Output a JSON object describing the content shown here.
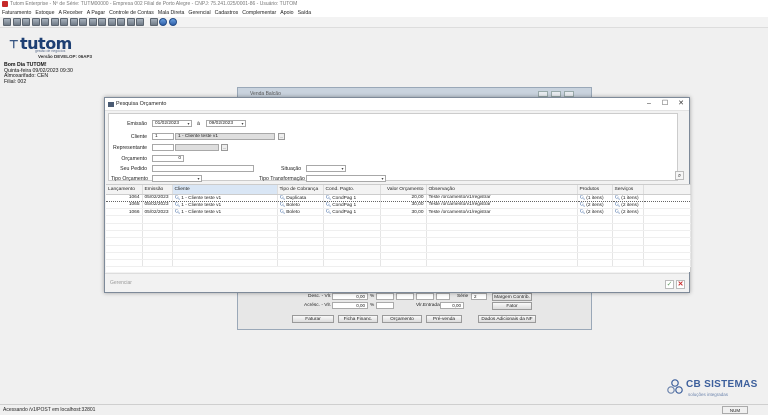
{
  "window": {
    "title": "Tutom Enterprise - Nº de Série: TUTM00000 - Empresa 002 Filial de Porto Alegre - CNPJ: 75.241.025/0001-86 - Usuário: TUTOM"
  },
  "menu": [
    "Faturamento",
    "Estoque",
    "A Receber",
    "A Pagar",
    "Controle de Contas",
    "Mala Direta",
    "Gerencial",
    "Cadastros",
    "Complementar",
    "Apoio",
    "Saída"
  ],
  "brand": {
    "name": "tutom",
    "tagline": "gestão de negócios",
    "version": "Versão DEVELOP: 06AP3"
  },
  "welcome": {
    "greeting": "Bom Dia TUTOM!",
    "date": "Quinta-feira 09/02/2023  09:30",
    "warehouse": "Almoxarifado: CEN",
    "branch": "Filial: 002"
  },
  "background_window": {
    "title": "Venda Balcão",
    "desc_label": "Desc. - Vlr.",
    "desc_value": "0,00",
    "acresc_label": "Acrésc. - Vlr.",
    "acresc_value": "0,00",
    "pct": "%",
    "entrada_label": "Vlr.Entrada",
    "entrada_value": "0,00",
    "serie_label": "Série",
    "serie_value": "2",
    "margem_label": "Margem Contrib.",
    "fator_label": "Fator",
    "buttons": [
      "Faturar",
      "Ficha Financ.",
      "Orçamento",
      "Pré-venda",
      "Dados Adicionais da NF"
    ]
  },
  "dialog": {
    "title": "Pesquisa Orçamento",
    "filters": {
      "emissao_label": "Emissão",
      "emissao_from": "01/02/2023",
      "emissao_sep": "à",
      "emissao_to": "09/02/2023",
      "cliente_label": "Cliente",
      "cliente_code": "1",
      "cliente_name": "1 - Cliente teste v1",
      "representante_label": "Representante",
      "orcamento_label": "Orçamento",
      "orcamento_value": "0",
      "seu_pedido_label": "Seu Pedido",
      "situacao_label": "Situação",
      "tipo_orcamento_label": "Tipo Orçamento",
      "tipo_transformacao_label": "Tipo Transformação",
      "ellipsis": "..."
    },
    "columns": [
      "Lançamento",
      "Emissão",
      "Cliente",
      "Tipo de Cobrança",
      "Cond. Pagto.",
      "Valor Orçamento",
      "Observação",
      "Produtos",
      "Serviços"
    ],
    "rows": [
      {
        "lancamento": "1064",
        "emissao": "05/02/2023",
        "cliente": "1 - Cliente teste v1",
        "cobranca": "Duplicata",
        "cond": "CondPag 1",
        "valor": "20,00",
        "obs": "Teste /orcamento/v1/registrar",
        "produtos": "(1 itens)",
        "servicos": "(1 itens)"
      },
      {
        "lancamento": "1065",
        "emissao": "05/02/2023",
        "cliente": "1 - Cliente teste v1",
        "cobranca": "Boleto",
        "cond": "CondPag 1",
        "valor": "30,00",
        "obs": "Teste /orcamento/v1/registrar",
        "produtos": "(2 itens)",
        "servicos": "(2 itens)"
      },
      {
        "lancamento": "1066",
        "emissao": "05/02/2023",
        "cliente": "1 - Cliente teste v1",
        "cobranca": "Boleto",
        "cond": "CondPag 1",
        "valor": "30,00",
        "obs": "Teste /orcamento/v1/registrar",
        "produtos": "(2 itens)",
        "servicos": "(2 itens)"
      }
    ],
    "gerenciar_label": "Gerenciar"
  },
  "corner_brand": {
    "name": "CB SISTEMAS",
    "tagline": "soluções integradas"
  },
  "statusbar": {
    "text": "Acessando /v1/POST em localhost:32801",
    "num": "NUM"
  },
  "colors": {
    "brand_blue": "#1d3f73",
    "header_selected": "#d9e6f5",
    "cancel_red": "#c62828",
    "ok_green": "#6aa26a"
  }
}
